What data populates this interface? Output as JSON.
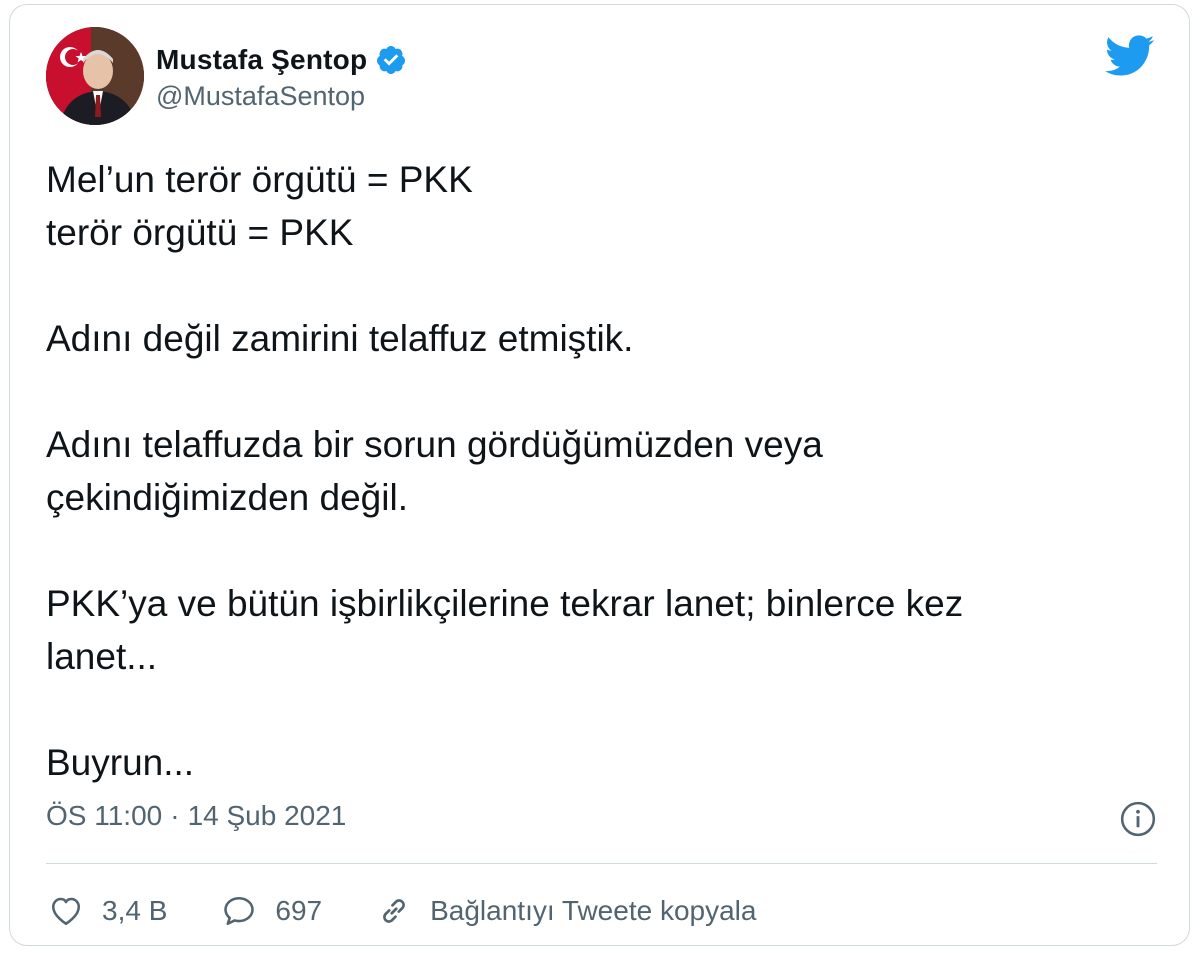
{
  "user": {
    "display_name": "Mustafa Şentop",
    "handle": "@MustafaSentop",
    "verified": true,
    "avatar_icon": "profile-photo"
  },
  "brand": {
    "icon": "twitter-bird-icon",
    "color": "#1d9bf0"
  },
  "tweet": {
    "lines": [
      "Mel’un terör örgütü = PKK",
      "terör örgütü = PKK",
      "",
      "Adını değil zamirini telaffuz etmiştik.",
      "",
      "Adını telaffuzda bir sorun gördüğümüzden veya",
      "çekindiğimizden değil.",
      "",
      "PKK’ya ve bütün işbirlikçilerine tekrar lanet; binlerce kez",
      "lanet...",
      "",
      "Buyrun..."
    ],
    "time": "ÖS 11:00",
    "separator": "·",
    "date": "14 Şub 2021"
  },
  "actions": {
    "like_count": "3,4 B",
    "reply_count": "697",
    "copy_link_label": "Bağlantıyı Tweete kopyala"
  },
  "colors": {
    "text": "#0f1419",
    "secondary": "#536471",
    "border": "#cfd9de",
    "verified": "#1d9bf0"
  }
}
